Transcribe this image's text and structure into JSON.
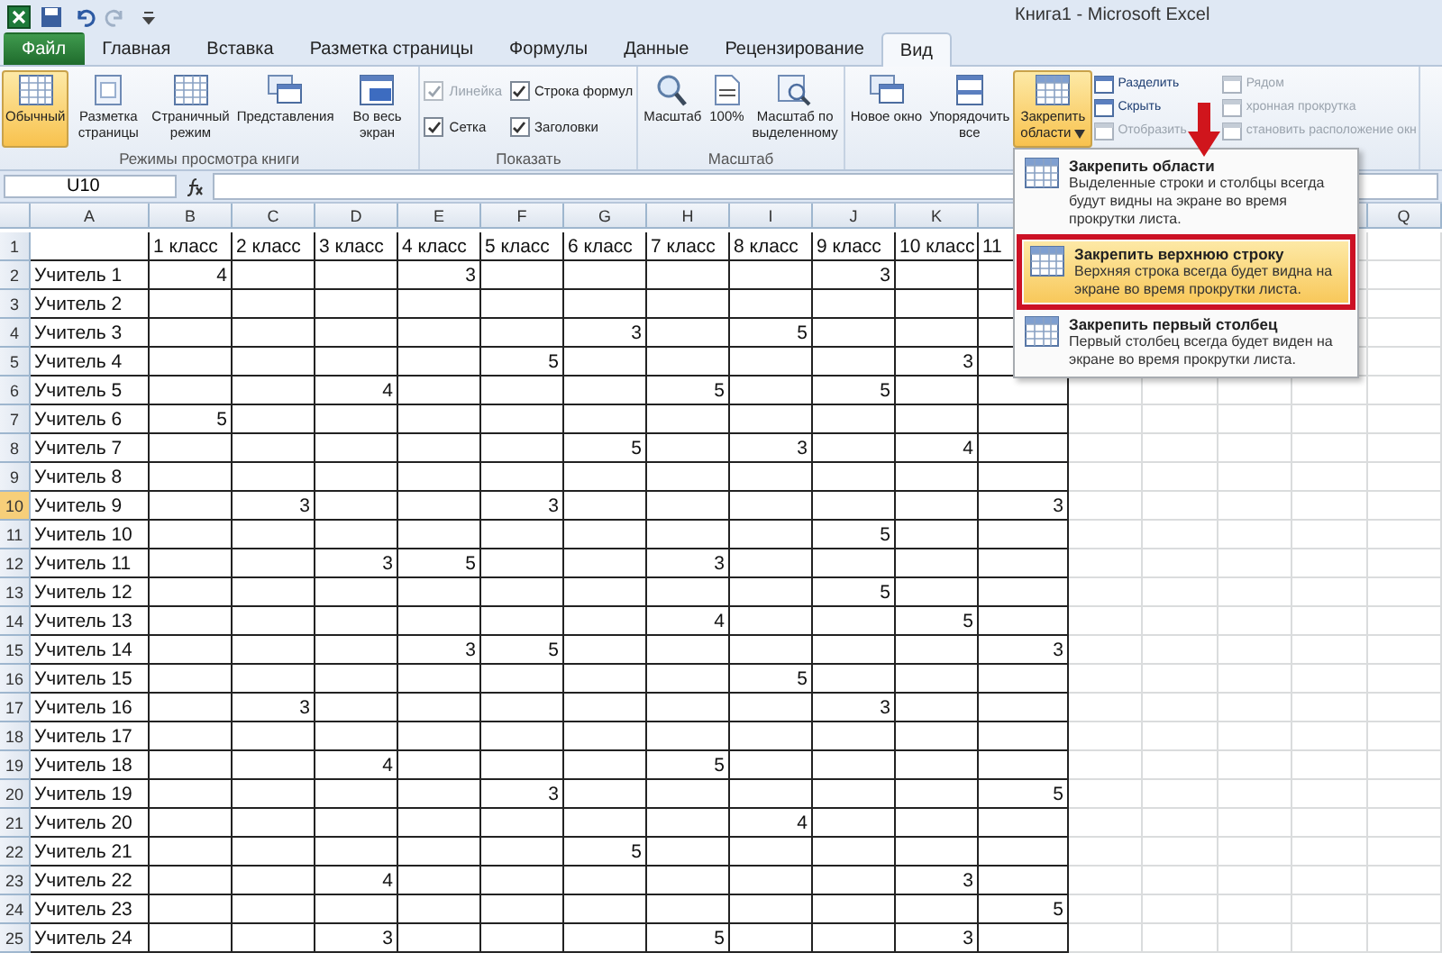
{
  "window": {
    "title": "Книга1  -  Microsoft Excel"
  },
  "tabs": [
    {
      "label": "Файл",
      "kind": "file",
      "selected": false
    },
    {
      "label": "Главная",
      "kind": "tab",
      "selected": false
    },
    {
      "label": "Вставка",
      "kind": "tab",
      "selected": false
    },
    {
      "label": "Разметка страницы",
      "kind": "tab",
      "selected": false
    },
    {
      "label": "Формулы",
      "kind": "tab",
      "selected": false
    },
    {
      "label": "Данные",
      "kind": "tab",
      "selected": false
    },
    {
      "label": "Рецензирование",
      "kind": "tab",
      "selected": false
    },
    {
      "label": "Вид",
      "kind": "tab",
      "selected": true
    }
  ],
  "ribbon": {
    "groups": [
      {
        "label": "Режимы просмотра книги",
        "items": [
          {
            "kind": "large",
            "label": "Обычный",
            "selected": true
          },
          {
            "kind": "large",
            "label": "Разметка страницы",
            "selected": false
          },
          {
            "kind": "large",
            "label": "Страничный режим",
            "selected": false
          },
          {
            "kind": "large",
            "label": "Представления",
            "selected": false
          },
          {
            "kind": "large",
            "label": "Во весь экран",
            "selected": false
          }
        ]
      },
      {
        "label": "Показать",
        "items": [
          {
            "kind": "check",
            "label": "Линейка",
            "checked": true,
            "disabled": true
          },
          {
            "kind": "check",
            "label": "Строка формул",
            "checked": true,
            "disabled": false
          },
          {
            "kind": "check",
            "label": "Сетка",
            "checked": true,
            "disabled": false
          },
          {
            "kind": "check",
            "label": "Заголовки",
            "checked": true,
            "disabled": false
          }
        ]
      },
      {
        "label": "Масштаб",
        "items": [
          {
            "kind": "large",
            "label": "Масштаб",
            "selected": false
          },
          {
            "kind": "large",
            "label": "100%",
            "selected": false
          },
          {
            "kind": "large",
            "label": "Масштаб по выделенному",
            "selected": false
          }
        ]
      },
      {
        "items": [
          {
            "kind": "large",
            "label": "Новое окно",
            "selected": false
          },
          {
            "kind": "large",
            "label": "Упорядочить все",
            "selected": false
          },
          {
            "kind": "large",
            "label": "Закрепить области",
            "selected": true,
            "dropdown": true
          },
          {
            "kind": "small",
            "label": "Разделить",
            "disabled": false
          },
          {
            "kind": "small",
            "label": "Скрыть",
            "disabled": false
          },
          {
            "kind": "small",
            "label": "Отобразить",
            "disabled": true
          },
          {
            "kind": "small",
            "label": "Рядом",
            "disabled": true
          },
          {
            "kind": "small",
            "label": "хронная прокрутка",
            "disabled": true
          },
          {
            "kind": "small",
            "label": "становить расположение окн",
            "disabled": true
          }
        ]
      }
    ]
  },
  "formula_bar": {
    "name_box": "U10"
  },
  "freeze_menu": {
    "items": [
      {
        "title": "Закрепить области",
        "description": "Выделенные строки и столбцы всегда будут видны на экране во время прокрутки листа.",
        "selected": false
      },
      {
        "title": "Закрепить верхнюю строку",
        "description": "Верхняя строка всегда будет видна на экране во время прокрутки листа.",
        "selected": true
      },
      {
        "title": "Закрепить первый столбец",
        "description": "Первый столбец всегда будет виден на экране во время прокрутки листа.",
        "selected": false
      }
    ]
  },
  "sheet": {
    "columns": [
      "A",
      "B",
      "C",
      "D",
      "E",
      "F",
      "G",
      "H",
      "I",
      "J",
      "K",
      null,
      null,
      null,
      null,
      null,
      "Q"
    ],
    "rows": [
      {
        "number": "1",
        "label": null,
        "selected": false,
        "cells": [
          "1 класс",
          "2 класс",
          "3 класс",
          "4 класс",
          "5 класс",
          "6 класс",
          "7 класс",
          "8 класс",
          "9 класс",
          "10 класс",
          "11"
        ]
      },
      {
        "number": "2",
        "label": "Учитель 1",
        "selected": false,
        "cells": [
          "4",
          null,
          null,
          "3",
          null,
          null,
          null,
          null,
          "3",
          null,
          null
        ]
      },
      {
        "number": "3",
        "label": "Учитель 2",
        "selected": false,
        "cells": [
          null,
          null,
          null,
          null,
          null,
          null,
          null,
          null,
          null,
          null,
          null
        ]
      },
      {
        "number": "4",
        "label": "Учитель 3",
        "selected": false,
        "cells": [
          null,
          null,
          null,
          null,
          null,
          "3",
          null,
          "5",
          null,
          null,
          null
        ]
      },
      {
        "number": "5",
        "label": "Учитель 4",
        "selected": false,
        "cells": [
          null,
          null,
          null,
          null,
          "5",
          null,
          null,
          null,
          null,
          "3",
          null
        ]
      },
      {
        "number": "6",
        "label": "Учитель 5",
        "selected": false,
        "cells": [
          null,
          null,
          "4",
          null,
          null,
          null,
          "5",
          null,
          "5",
          null,
          null
        ]
      },
      {
        "number": "7",
        "label": "Учитель 6",
        "selected": false,
        "cells": [
          "5",
          null,
          null,
          null,
          null,
          null,
          null,
          null,
          null,
          null,
          null
        ]
      },
      {
        "number": "8",
        "label": "Учитель 7",
        "selected": false,
        "cells": [
          null,
          null,
          null,
          null,
          null,
          "5",
          null,
          "3",
          null,
          "4",
          null
        ]
      },
      {
        "number": "9",
        "label": "Учитель 8",
        "selected": false,
        "cells": [
          null,
          null,
          null,
          null,
          null,
          null,
          null,
          null,
          null,
          null,
          null
        ]
      },
      {
        "number": "10",
        "label": "Учитель 9",
        "selected": true,
        "cells": [
          null,
          "3",
          null,
          null,
          "3",
          null,
          null,
          null,
          null,
          null,
          "3"
        ]
      },
      {
        "number": "11",
        "label": "Учитель 10",
        "selected": false,
        "cells": [
          null,
          null,
          null,
          null,
          null,
          null,
          null,
          null,
          "5",
          null,
          null
        ]
      },
      {
        "number": "12",
        "label": "Учитель 11",
        "selected": false,
        "cells": [
          null,
          null,
          "3",
          "5",
          null,
          null,
          "3",
          null,
          null,
          null,
          null
        ]
      },
      {
        "number": "13",
        "label": "Учитель 12",
        "selected": false,
        "cells": [
          null,
          null,
          null,
          null,
          null,
          null,
          null,
          null,
          "5",
          null,
          null
        ]
      },
      {
        "number": "14",
        "label": "Учитель 13",
        "selected": false,
        "cells": [
          null,
          null,
          null,
          null,
          null,
          null,
          "4",
          null,
          null,
          "5",
          null
        ]
      },
      {
        "number": "15",
        "label": "Учитель 14",
        "selected": false,
        "cells": [
          null,
          null,
          null,
          "3",
          "5",
          null,
          null,
          null,
          null,
          null,
          "3"
        ]
      },
      {
        "number": "16",
        "label": "Учитель 15",
        "selected": false,
        "cells": [
          null,
          null,
          null,
          null,
          null,
          null,
          null,
          "5",
          null,
          null,
          null
        ]
      },
      {
        "number": "17",
        "label": "Учитель 16",
        "selected": false,
        "cells": [
          null,
          "3",
          null,
          null,
          null,
          null,
          null,
          null,
          "3",
          null,
          null
        ]
      },
      {
        "number": "18",
        "label": "Учитель 17",
        "selected": false,
        "cells": [
          null,
          null,
          null,
          null,
          null,
          null,
          null,
          null,
          null,
          null,
          null
        ]
      },
      {
        "number": "19",
        "label": "Учитель 18",
        "selected": false,
        "cells": [
          null,
          null,
          "4",
          null,
          null,
          null,
          "5",
          null,
          null,
          null,
          null
        ]
      },
      {
        "number": "20",
        "label": "Учитель 19",
        "selected": false,
        "cells": [
          null,
          null,
          null,
          null,
          "3",
          null,
          null,
          null,
          null,
          null,
          "5"
        ]
      },
      {
        "number": "21",
        "label": "Учитель 20",
        "selected": false,
        "cells": [
          null,
          null,
          null,
          null,
          null,
          null,
          null,
          "4",
          null,
          null,
          null
        ]
      },
      {
        "number": "22",
        "label": "Учитель 21",
        "selected": false,
        "cells": [
          null,
          null,
          null,
          null,
          null,
          "5",
          null,
          null,
          null,
          null,
          null
        ]
      },
      {
        "number": "23",
        "label": "Учитель 22",
        "selected": false,
        "cells": [
          null,
          null,
          "4",
          null,
          null,
          null,
          null,
          null,
          null,
          "3",
          null
        ]
      },
      {
        "number": "24",
        "label": "Учитель 23",
        "selected": false,
        "cells": [
          null,
          null,
          null,
          null,
          null,
          null,
          null,
          null,
          null,
          null,
          "5"
        ]
      },
      {
        "number": "25",
        "label": "Учитель 24",
        "selected": false,
        "cells": [
          null,
          null,
          "3",
          null,
          null,
          null,
          "5",
          null,
          null,
          "3",
          null
        ]
      }
    ]
  }
}
